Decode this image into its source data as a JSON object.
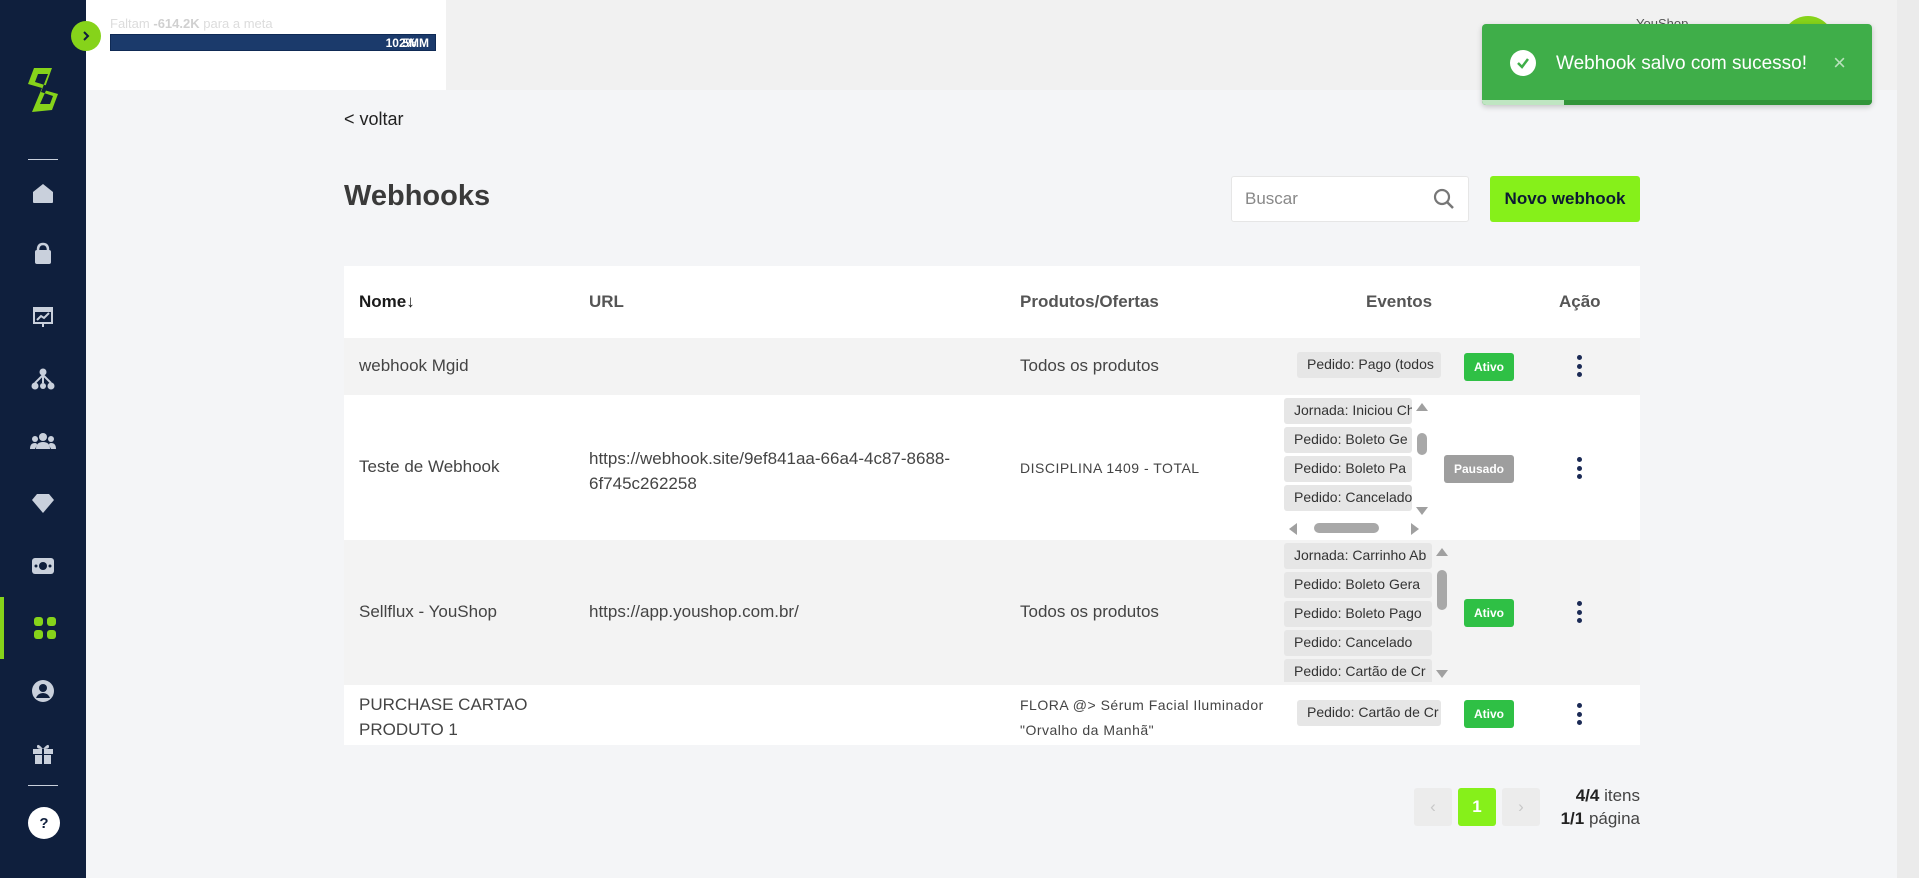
{
  "goal": {
    "text_prefix": "Faltam",
    "remaining": "-614.2K",
    "text_suffix": "para a meta",
    "bar_label": "102%",
    "bar_overlay_label": "5MM",
    "progress_fraction": 1.0
  },
  "user": {
    "name": "YouShop"
  },
  "toast": {
    "message": "Webhook salvo com sucesso!",
    "close_glyph": "×",
    "progress_fraction": 0.21
  },
  "nav": {
    "back": "< voltar",
    "items": [
      {
        "icon": "home-icon"
      },
      {
        "icon": "shopping-bag-icon"
      },
      {
        "icon": "presentation-chart-icon"
      },
      {
        "icon": "network-icon"
      },
      {
        "icon": "users-icon"
      },
      {
        "icon": "diamond-icon"
      },
      {
        "icon": "money-icon"
      },
      {
        "icon": "apps-grid-icon",
        "active": true
      },
      {
        "icon": "user-circle-icon"
      },
      {
        "icon": "gift-icon"
      }
    ],
    "help": "?"
  },
  "page": {
    "title": "Webhooks",
    "search_placeholder": "Buscar",
    "new_button": "Novo webhook"
  },
  "table": {
    "headers": {
      "name": "Nome",
      "sort_glyph": "↓",
      "url": "URL",
      "products": "Produtos/Ofertas",
      "events": "Eventos",
      "action": "Ação"
    },
    "rows": [
      {
        "name": "webhook Mgid",
        "url": "",
        "products": "Todos os produtos",
        "events": [
          "Pedido: Pago (todos"
        ],
        "status": "Ativo"
      },
      {
        "name": "Teste de Webhook",
        "url_line1": "https://webhook.site/9ef841aa-66a4-4c87-8688-",
        "url_line2": "6f745c262258",
        "products": "DISCIPLINA 1409 - TOTAL",
        "events": [
          "Jornada: Iniciou Ch",
          "Pedido: Boleto Ge",
          "Pedido: Boleto Pa",
          "Pedido: Cancelado"
        ],
        "status": "Pausado"
      },
      {
        "name": "Sellflux - YouShop",
        "url": "https://app.youshop.com.br/",
        "products": "Todos os produtos",
        "events": [
          "Jornada: Carrinho Ab",
          "Pedido: Boleto Gera",
          "Pedido: Boleto Pago",
          "Pedido: Cancelado",
          "Pedido: Cartão de Cr"
        ],
        "status": "Ativo"
      },
      {
        "name_line1": "PURCHASE CARTAO",
        "name_line2": "PRODUTO 1",
        "url": "",
        "products_line1": "FLORA @> Sérum Facial Iluminador",
        "products_line2": "\"Orvalho da Manhã\"",
        "events": [
          "Pedido: Cartão de Cr"
        ],
        "status": "Ativo"
      }
    ]
  },
  "pagination": {
    "prev": "‹",
    "current": "1",
    "next": "›",
    "items_count": "4/4",
    "items_label": "itens",
    "pages_count": "1/1",
    "pages_label": "página"
  },
  "colors": {
    "sidebar": "#0f1f3d",
    "accent": "#86f01a",
    "toast": "#3fae49",
    "active_status": "#2fc045",
    "paused_status": "#9e9e9e"
  }
}
